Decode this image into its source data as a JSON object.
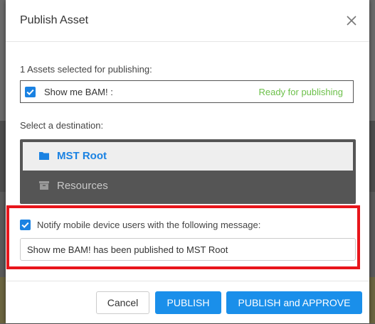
{
  "dialog": {
    "title": "Publish Asset",
    "close_icon": "close-icon"
  },
  "selection": {
    "label": "1 Assets selected for publishing:",
    "asset": {
      "name": "Show me BAM!  :",
      "checked": true,
      "status": "Ready for publishing",
      "status_color": "#6cc04a"
    }
  },
  "destination": {
    "label": "Select a destination:",
    "items": [
      {
        "label": "MST Root",
        "icon": "folder-icon",
        "selected": true
      },
      {
        "label": "Resources",
        "icon": "archive-box-icon",
        "selected": false
      }
    ]
  },
  "notify": {
    "checked": true,
    "label": "Notify mobile device users with the following message:",
    "message": "Show me BAM! has been published to MST Root"
  },
  "footer": {
    "cancel_label": "Cancel",
    "publish_label": "PUBLISH",
    "approve_label": "PUBLISH and APPROVE"
  },
  "colors": {
    "accent": "#1a82e2",
    "highlight": "#e8151b",
    "ready": "#6cc04a"
  }
}
